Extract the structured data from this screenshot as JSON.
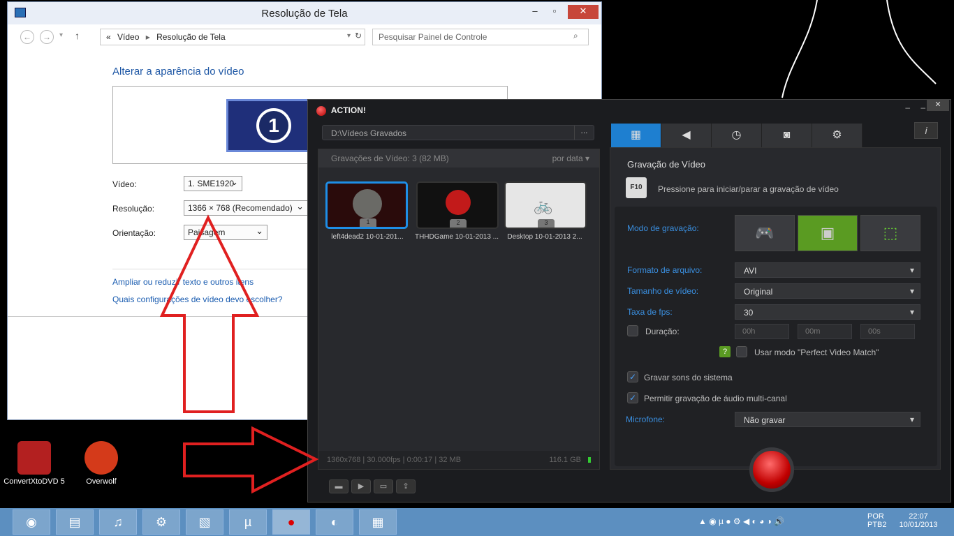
{
  "desktop": {
    "icons": [
      {
        "label": "ConvertXtoDVD 5",
        "icon": "convertxtodvd-icon"
      },
      {
        "label": "Overwolf",
        "icon": "overwolf-icon"
      }
    ]
  },
  "control_panel": {
    "title": "Resolução de Tela",
    "breadcrumb_prefix": "«",
    "breadcrumb_1": "Vídeo",
    "breadcrumb_2": "Resolução de Tela",
    "search_placeholder": "Pesquisar Painel de Controle",
    "heading": "Alterar a aparência do vídeo",
    "monitor_number": "1",
    "video_label": "Vídeo:",
    "video_value": "1. SME1920",
    "resolution_label": "Resolução:",
    "resolution_value": "1366 × 768 (Recomendado)",
    "orientation_label": "Orientação:",
    "orientation_value": "Paisagem",
    "link_1": "Ampliar ou reduzir texto e outros itens",
    "link_2": "Quais configurações de vídeo devo escolher?"
  },
  "action": {
    "title": "ACTION!",
    "path": "D:\\Vídeos Gravados",
    "path_button": "...",
    "recordings_header": "Gravações de Vídeo: 3 (82 MB)",
    "sort_label": "por data",
    "thumbnails": [
      {
        "label": "left4dead2 10-01-201...",
        "num": "1"
      },
      {
        "label": "THHDGame 10-01-2013 ...",
        "num": "2"
      },
      {
        "label": "Desktop 10-01-2013 2...",
        "num": "3"
      }
    ],
    "status_left": "1360x768 | 30.000fps | 0:00:17 | 32 MB",
    "status_right": "116.1 GB",
    "panel_title": "Gravação de Vídeo",
    "f10_key": "F10",
    "hint": "Pressione para iniciar/parar a gravação de vídeo",
    "mode_label": "Modo de gravação:",
    "format_label": "Formato de arquivo:",
    "format_value": "AVI",
    "size_label": "Tamanho de vídeo:",
    "size_value": "Original",
    "fps_label": "Taxa de fps:",
    "fps_value": "30",
    "duration_label": "Duração:",
    "dur_h": "00h",
    "dur_m": "00m",
    "dur_s": "00s",
    "perfect_match_label": "Usar modo \"Perfect Video Match\"",
    "system_sounds_label": "Gravar sons do sistema",
    "multichannel_label": "Permitir gravação de áudio multi-canal",
    "mic_label": "Microfone:",
    "mic_value": "Não gravar",
    "info_label": "i"
  },
  "taskbar": {
    "lang_1": "POR",
    "lang_2": "PTB2",
    "time": "22:07",
    "date": "10/01/2013"
  },
  "colors": {
    "accent_blue": "#1e7fd0",
    "record_red": "#c00000",
    "mode_green": "#5a9b22"
  }
}
